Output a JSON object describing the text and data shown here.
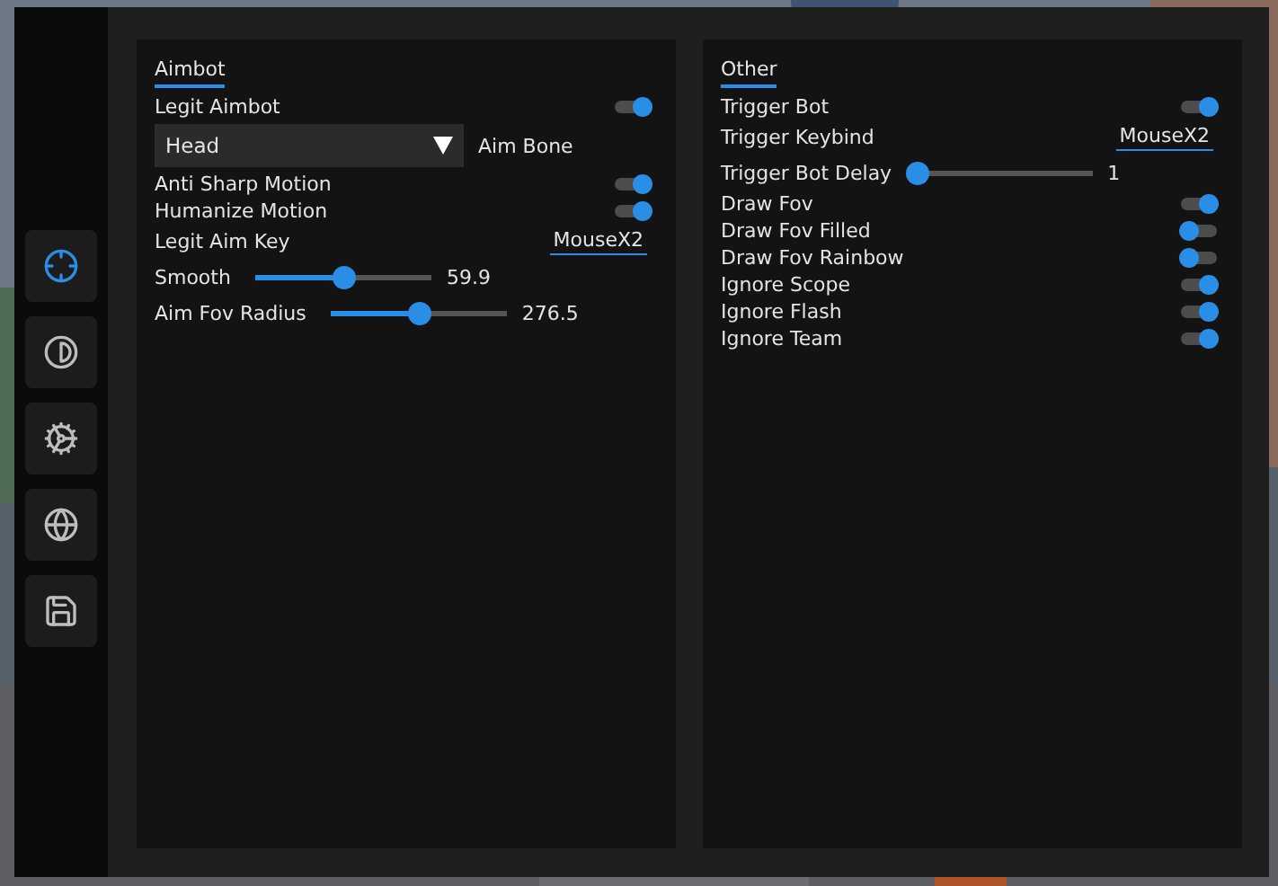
{
  "sidebar": {
    "items": [
      {
        "selected": true
      },
      {
        "selected": false
      },
      {
        "selected": false
      },
      {
        "selected": false
      },
      {
        "selected": false
      }
    ]
  },
  "panels": [
    {
      "title": "Aimbot",
      "items": [
        {
          "kind": "toggle",
          "label": "Legit Aimbot",
          "on": true
        },
        {
          "kind": "combo",
          "selection": "Head",
          "label": "Aim Bone"
        },
        {
          "kind": "toggle",
          "label": "Anti Sharp Motion",
          "on": true
        },
        {
          "kind": "toggle",
          "label": "Humanize Motion",
          "on": true
        },
        {
          "kind": "keybind",
          "label": "Legit Aim Key",
          "value": "MouseX2"
        },
        {
          "kind": "slider",
          "label": "Smooth",
          "level": 0.53,
          "reading": "59.9"
        },
        {
          "kind": "slider",
          "label": "Aim Fov Radius",
          "level": 0.54,
          "reading": "276.5"
        }
      ]
    },
    {
      "title": "Other",
      "items": [
        {
          "kind": "toggle",
          "label": "Trigger Bot",
          "on": true
        },
        {
          "kind": "keybind",
          "label": "Trigger Keybind",
          "value": "MouseX2"
        },
        {
          "kind": "slider",
          "label": "Trigger Bot Delay",
          "level": 0,
          "reading": "1"
        },
        {
          "kind": "toggle",
          "label": "Draw Fov",
          "on": true
        },
        {
          "kind": "toggle",
          "label": "Draw Fov Filled",
          "on": false
        },
        {
          "kind": "toggle",
          "label": "Draw Fov Rainbow",
          "on": false
        },
        {
          "kind": "toggle",
          "label": "Ignore Scope",
          "on": true
        },
        {
          "kind": "toggle",
          "label": "Ignore Flash",
          "on": true
        },
        {
          "kind": "toggle",
          "label": "Ignore Team",
          "on": true
        }
      ]
    }
  ]
}
